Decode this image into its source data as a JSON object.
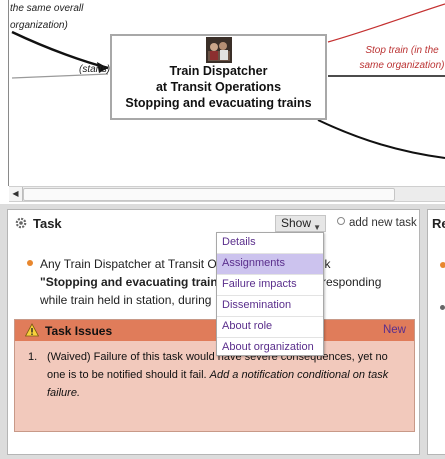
{
  "diagram": {
    "top_left_text": [
      "the same overall",
      "organization)"
    ],
    "starts_label": "(starts)",
    "right_edge_label": [
      "Stop train (in the",
      "same organization)"
    ],
    "node": {
      "lines": [
        "Train Dispatcher",
        "at Transit Operations",
        "Stopping and evacuating trains"
      ]
    }
  },
  "task_panel": {
    "title": "Task",
    "show_label": "Show",
    "add_task_label": "add new task",
    "description": {
      "prefix": "Any Train Dispatcher at Transit O",
      "prefix_tail": "ed task",
      "task_name": "\"Stopping and evacuating trains",
      "mid": "th \"responding",
      "line3": "while train held in station, during",
      "line3_tail": "\"."
    },
    "issues": {
      "title": "Task Issues",
      "new_label": "New",
      "items": [
        {
          "number": "1.",
          "text": "(Waived) Failure of this task would have severe consequences, yet no one is to be notified should it fail.",
          "suggestion": "Add a notification conditional on task failure."
        }
      ]
    }
  },
  "show_menu": {
    "items": [
      "Details",
      "Assignments",
      "Failure impacts",
      "Dissemination",
      "About role",
      "About organization"
    ],
    "active_index": 1
  },
  "right_panel": {
    "title_fragment": "Re"
  },
  "colors": {
    "issues_header": "#e07c5a",
    "issues_body": "#f2c9bc",
    "menu_active": "#ccc3ee",
    "link": "#5a2e8c",
    "bullet": "#e8872e"
  }
}
